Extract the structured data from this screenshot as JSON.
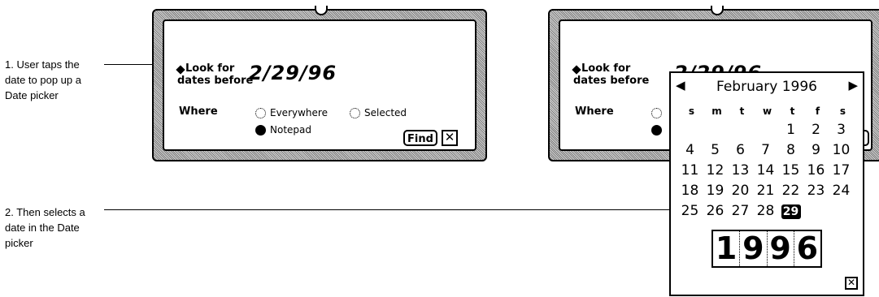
{
  "callouts": [
    {
      "lines": [
        "1. User taps the",
        "date to pop up a",
        "Date picker"
      ]
    },
    {
      "lines": [
        "2. Then selects a",
        "date in the Date",
        "picker"
      ]
    }
  ],
  "find_slip": {
    "look_for_line1": "Look for",
    "look_for_line2": "dates before",
    "date_value": "2/29/96",
    "date_value_obscured": "2/29/96",
    "where_label": "Where",
    "options": {
      "everywhere": "Everywhere",
      "selected": "Selected",
      "notepad": "Notepad"
    },
    "selected_option": "Notepad",
    "find_button": "Find",
    "close_icon": "close-box-icon"
  },
  "date_picker": {
    "month_year": "February 1996",
    "prev_icon": "left-arrow-icon",
    "next_icon": "right-arrow-icon",
    "weekdays": [
      "s",
      "m",
      "t",
      "w",
      "t",
      "f",
      "s"
    ],
    "leading_blanks": 4,
    "days": [
      "1",
      "2",
      "3",
      "4",
      "5",
      "6",
      "7",
      "8",
      "9",
      "10",
      "11",
      "12",
      "13",
      "14",
      "15",
      "16",
      "17",
      "18",
      "19",
      "20",
      "21",
      "22",
      "23",
      "24",
      "25",
      "26",
      "27",
      "28",
      "29"
    ],
    "selected_day": "29",
    "year_digits": [
      "1",
      "9",
      "9",
      "6"
    ],
    "close_icon": "close-box-icon"
  }
}
